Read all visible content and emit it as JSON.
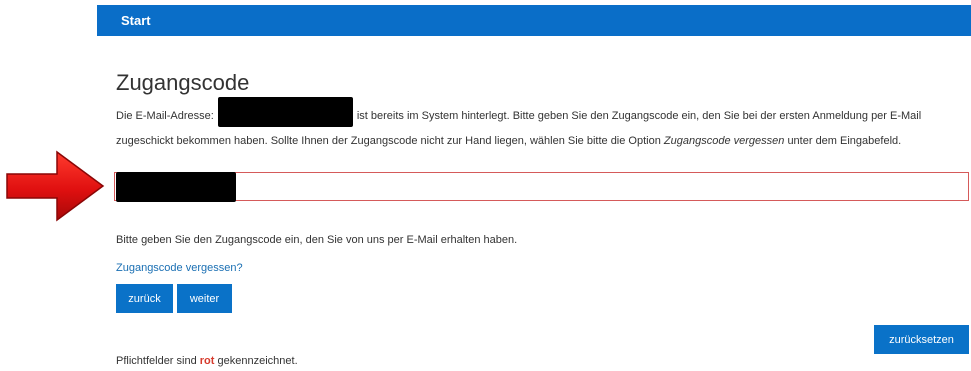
{
  "nav": {
    "start_label": "Start"
  },
  "form": {
    "title": "Zugangscode",
    "desc_part1": "Die E-Mail-Adresse:",
    "desc_part2": "ist bereits im System hinterlegt. Bitte geben Sie den Zugangscode ein, den Sie bei der ersten Anmeldung per E-Mail zugeschickt bekommen haben. Sollte Ihnen der Zugangscode nicht zur Hand liegen, wählen Sie bitte die Option",
    "desc_option": "Zugangscode vergessen",
    "desc_part3": "unter dem Eingabefeld.",
    "code_value": "",
    "hint": "Bitte geben Sie den Zugangscode ein, den Sie von uns per E-Mail erhalten haben.",
    "forgot_link": "Zugangscode vergessen?",
    "back_button": "zurück",
    "next_button": "weiter",
    "reset_button": "zurücksetzen",
    "footnote_before": "Pflichtfelder sind",
    "footnote_red": "rot",
    "footnote_after": "gekennzeichnet."
  },
  "colors": {
    "primary": "#0a6ec8",
    "link": "#1a6fb3",
    "required": "#d63a2c",
    "field_border": "#d55a5a",
    "arrow": "#e01010"
  },
  "icons": {
    "pointer": "red-arrow-icon"
  }
}
